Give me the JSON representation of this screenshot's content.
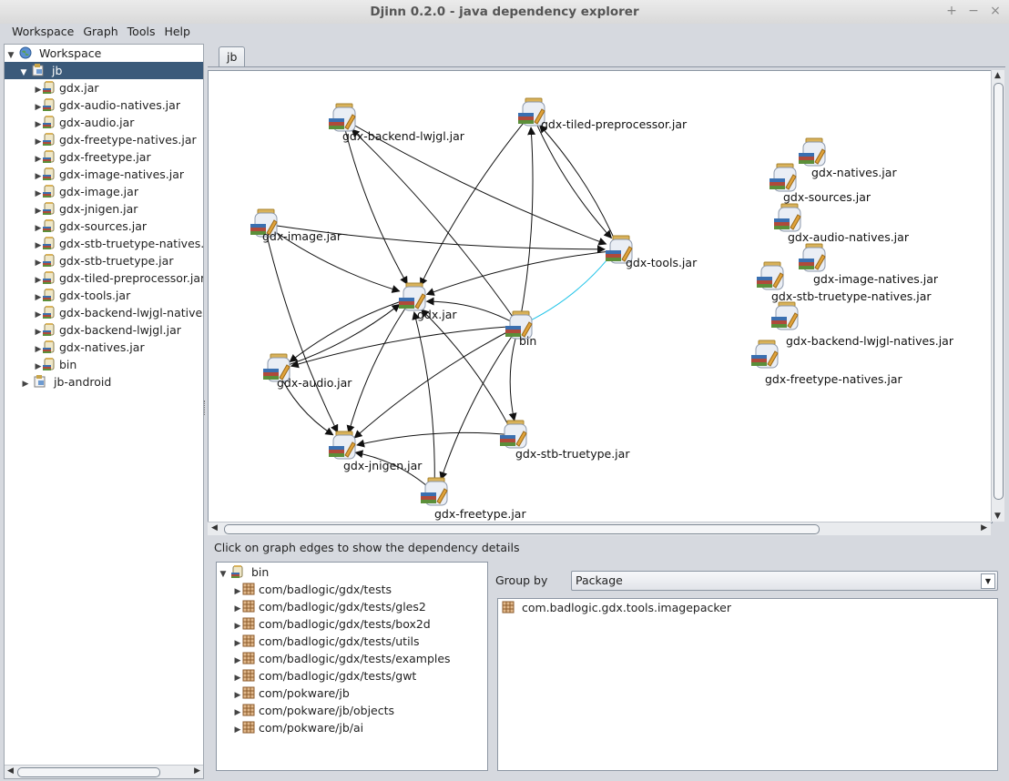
{
  "window": {
    "title": "Djinn 0.2.0 - java dependency explorer",
    "buttons": [
      "+",
      "−",
      "×"
    ]
  },
  "menu": [
    "Workspace",
    "Graph",
    "Tools",
    "Help"
  ],
  "workspace_tree": {
    "root": "Workspace",
    "project": "jb",
    "items": [
      "gdx.jar",
      "gdx-audio-natives.jar",
      "gdx-audio.jar",
      "gdx-freetype-natives.jar",
      "gdx-freetype.jar",
      "gdx-image-natives.jar",
      "gdx-image.jar",
      "gdx-jnigen.jar",
      "gdx-sources.jar",
      "gdx-stb-truetype-natives.jar",
      "gdx-stb-truetype.jar",
      "gdx-tiled-preprocessor.jar",
      "gdx-tools.jar",
      "gdx-backend-lwjgl-natives.jar",
      "gdx-backend-lwjgl.jar",
      "gdx-natives.jar",
      "bin"
    ],
    "other_project": "jb-android"
  },
  "graph_tab": "jb",
  "graph_nodes": [
    "gdx-backend-lwjgl.jar",
    "gdx-tiled-preprocessor.jar",
    "gdx-image.jar",
    "gdx-tools.jar",
    "gdx.jar",
    "bin",
    "gdx-audio.jar",
    "gdx-jnigen.jar",
    "gdx-stb-truetype.jar",
    "gdx-freetype.jar",
    "gdx-natives.jar",
    "gdx-sources.jar",
    "gdx-audio-natives.jar",
    "gdx-image-natives.jar",
    "gdx-stb-truetype-natives.jar",
    "gdx-backend-lwjgl-natives.jar",
    "gdx-freetype-natives.jar"
  ],
  "hint": "Click on graph edges to show the dependency details",
  "dependency_tree": {
    "root": "bin",
    "packages": [
      "com/badlogic/gdx/tests",
      "com/badlogic/gdx/tests/gles2",
      "com/badlogic/gdx/tests/box2d",
      "com/badlogic/gdx/tests/utils",
      "com/badlogic/gdx/tests/examples",
      "com/badlogic/gdx/tests/gwt",
      "com/pokware/jb",
      "com/pokware/jb/objects",
      "com/pokware/jb/ai"
    ]
  },
  "group_by": {
    "label": "Group by",
    "selected": "Package"
  },
  "package_list": [
    "com.badlogic.gdx.tools.imagepacker"
  ]
}
